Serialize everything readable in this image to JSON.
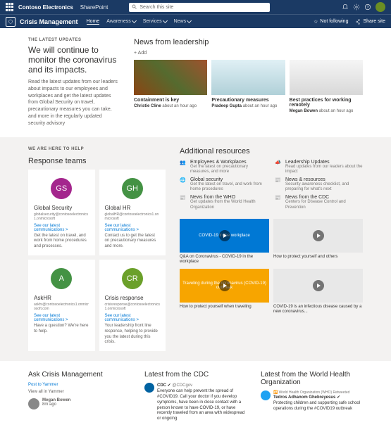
{
  "suite": {
    "brand": "Contoso Electronics",
    "app": "SharePoint",
    "search_placeholder": "Search this site"
  },
  "hub": {
    "site": "Crisis Management",
    "nav": [
      "Home",
      "Awareness",
      "Services",
      "News"
    ],
    "not_following": "Not following",
    "share": "Share site"
  },
  "hero": {
    "eyebrow": "THE LATEST UPDATES",
    "title": "We will continue to monitor the coronavirus and its impacts.",
    "body": "Read the latest updates from our leaders about impacts to our employees and workplaces and get the latest updates from Global Security on travel, precautionary measures you can take, and more in the regularly updated security advisory"
  },
  "news": {
    "heading": "News from leadership",
    "add": "+ Add",
    "items": [
      {
        "title": "Containment is key",
        "author": "Christie Cline",
        "when": "about an hour ago"
      },
      {
        "title": "Precautionary measures",
        "author": "Pradeep Gupta",
        "when": "about an hour ago"
      },
      {
        "title": "Best practices for working remotely",
        "author": "Megan Bowen",
        "when": "about an hour ago"
      }
    ]
  },
  "help": {
    "eyebrow": "WE ARE HERE TO HELP",
    "heading": "Response teams",
    "teams": [
      {
        "initials": "GS",
        "color": "#a4268d",
        "name": "Global Security",
        "email": "globalsecurity@contosoelectronics1.onmicrosoft",
        "link": "See our latest communications >",
        "desc": "Get the latest on travel, and work from home procedures and processes."
      },
      {
        "initials": "GH",
        "color": "#449244",
        "name": "Global HR",
        "email": "globalHR@contosoelectronics1.onmicrosoft",
        "link": "See our latest communications >",
        "desc": "Contact us to get the latest on precautionary measures and more."
      },
      {
        "initials": "A",
        "color": "#449244",
        "name": "AskHR",
        "email": "askhr@contosoelectronics1.onmicrosoft.com",
        "link": "See our latest communications >",
        "desc": "Have a question? We're here to help."
      },
      {
        "initials": "CR",
        "color": "#6ba02a",
        "name": "Crisis response",
        "email": "crisisresponse@contosoelectronics1.onmicrosoft",
        "link": "See our latest communications >",
        "desc": "Your leadership front line response, helping to provide you the latest during this crisis."
      }
    ]
  },
  "resources": {
    "heading": "Additional resources",
    "items": [
      {
        "title": "Employees & Workplaces",
        "desc": "Get the latest on precautionary measures, and more"
      },
      {
        "title": "Leadership Updates",
        "desc": "Read updates from our leaders about the impact"
      },
      {
        "title": "Global security",
        "desc": "Get the latest on travel, and work from home procedures"
      },
      {
        "title": "News & resources",
        "desc": "Security awareness checklist, and preparing for what's next"
      },
      {
        "title": "News from the WHO",
        "desc": "Get updates from the World Health Organization"
      },
      {
        "title": "News from the CDC",
        "desc": "Centers for Disease Control and Prevention"
      }
    ],
    "videos": [
      {
        "title": "Q&A on Coronavirus - COVID-19 in the workplace",
        "thumb_text": "COVID-19 in the workplace",
        "bg": "#0078d4"
      },
      {
        "title": "How to protect yourself and others",
        "thumb_text": "",
        "bg": "#e8e8e8"
      },
      {
        "title": "How to protect yourself when traveling",
        "thumb_text": "Traveling during the coronavirus (COVID-19) outbreak",
        "bg": "#f7a500"
      },
      {
        "title": "COVID-19 is an infectious disease caused by a new coronavirus...",
        "thumb_text": "",
        "bg": "#e8e8e8"
      }
    ]
  },
  "bottom": {
    "yammer": {
      "heading": "Ask Crisis Management",
      "post_link": "Post to Yammer",
      "view_all": "View all in Yammer",
      "post": {
        "author": "Megan Bowen",
        "when": "8m ago"
      }
    },
    "cdc": {
      "heading": "Latest from the CDC",
      "name": "CDC",
      "handle": "@CDCgov",
      "body": "Everyone can help prevent the spread of #COVID19. Call your doctor if you develop symptoms, have been in close contact with a person known to have COVID-19, or have recently traveled from an area with widespread or ongoing"
    },
    "who": {
      "heading": "Latest from the World Health Organization",
      "retweet": "World Health Organization (WHO) Retweeted",
      "name": "Tedros Adhanom Ghebreyesus",
      "handle": "",
      "body": "Protecting children and supporting safe school operations during the #COVID19 outbreak"
    }
  }
}
